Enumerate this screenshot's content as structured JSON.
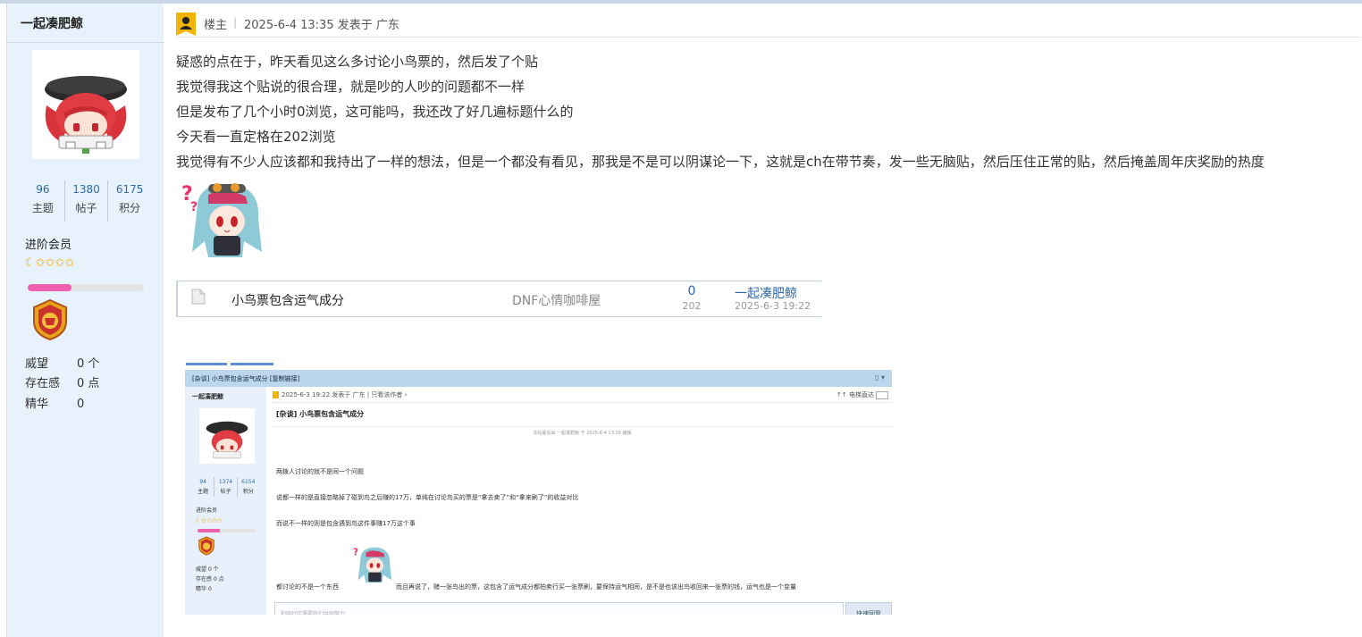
{
  "colors": {
    "sidebar_bg": "#e8f2fc",
    "link_blue": "#2e6aa6",
    "progress_pink": "#f060b0",
    "star_gold": "#f0a800",
    "op_badge": "#f0b400"
  },
  "icons": {
    "op": "user-badge-icon",
    "thread": "document-icon",
    "medal": "level-medal-icon",
    "level_stars": "moon-and-stars-icon"
  },
  "profile": {
    "username": "一起凑肥鲸",
    "stats": [
      {
        "value": "96",
        "label": "主题"
      },
      {
        "value": "1380",
        "label": "帖子"
      },
      {
        "value": "6175",
        "label": "积分"
      }
    ],
    "member_level": "进阶会员",
    "level_stars": "☾✩✩✩✩",
    "progress_fraction": 0.38,
    "fields": [
      {
        "label": "威望",
        "value": "0 个"
      },
      {
        "label": "存在感",
        "value": "0 点"
      },
      {
        "label": "精华",
        "value": "0"
      }
    ]
  },
  "post": {
    "op_label": "楼主",
    "separator": "|",
    "timestamp": "2025-6-4 13:35 发表于 广东",
    "lines": [
      "疑惑的点在于，昨天看见这么多讨论小鸟票的，然后发了个贴",
      "我觉得我这个贴说的很合理，就是吵的人吵的问题都不一样",
      "但是发布了几个小时0浏览，这可能吗，我还改了好几遍标题什么的",
      "今天看一直定格在202浏览",
      "我觉得有不少人应该都和我持出了一样的想法，但是一个都没有看见，那我是不是可以阴谋论一下，这就是ch在带节奏，发一些无脑贴，然后压住正常的贴，然后掩盖周年庆奖励的热度"
    ]
  },
  "thread_card": {
    "title": "小鸟票包含运气成分",
    "forum": "DNF心情咖啡屋",
    "replies": "0",
    "views": "202",
    "author": "一起凑肥鲸",
    "date": "2025-6-3 19:22"
  },
  "embedded": {
    "window_title": "[杂谈] 小鸟票包含运气成分 [复制链接]",
    "window_icons": "▯ ▾",
    "username": "一起凑肥鲸",
    "stats": [
      {
        "value": "94",
        "label": "主题"
      },
      {
        "value": "1374",
        "label": "帖子"
      },
      {
        "value": "6154",
        "label": "积分"
      }
    ],
    "member_level": "进阶会员",
    "level_stars": "☾✩✩✩✩",
    "progress_fraction": 0.38,
    "fields": [
      {
        "label": "威望",
        "value": "0 个"
      },
      {
        "label": "存在感",
        "value": "0 点"
      },
      {
        "label": "精华",
        "value": "0"
      }
    ],
    "post_meta": "2025-6-3 19:22 发表于 广东 | 只看该作者 ›",
    "post_right": "↑↑ 电梯直达",
    "post_title": "[杂谈] 小鸟票包含运气成分",
    "edit_note": "本帖最后由 一起凑肥鲸 于 2025-6-4 13:26 编辑",
    "lines": [
      "两拨人讨论的就不是同一个问题",
      "说都一样的是直接忽略掉了碰到鸟之后赚的17万，单纯在讨论鸟买的票是“拿去卖了”和“拿来刷了”的收益对比",
      "而说不一样的则是包含遇到鸟这件事赚17万这个事"
    ],
    "line_a": "都讨论的不是一个东西",
    "line_b": "而且再说了，赌一张鸟出的票，这包含了运气成分都拍卖行买一张票刷，要保持运气相同，是不是也该出鸟收回来一张票的钱，运气也是一个变量",
    "reply_placeholder": "和网社区需要我们共同努力",
    "reply_button": "快速回复"
  }
}
